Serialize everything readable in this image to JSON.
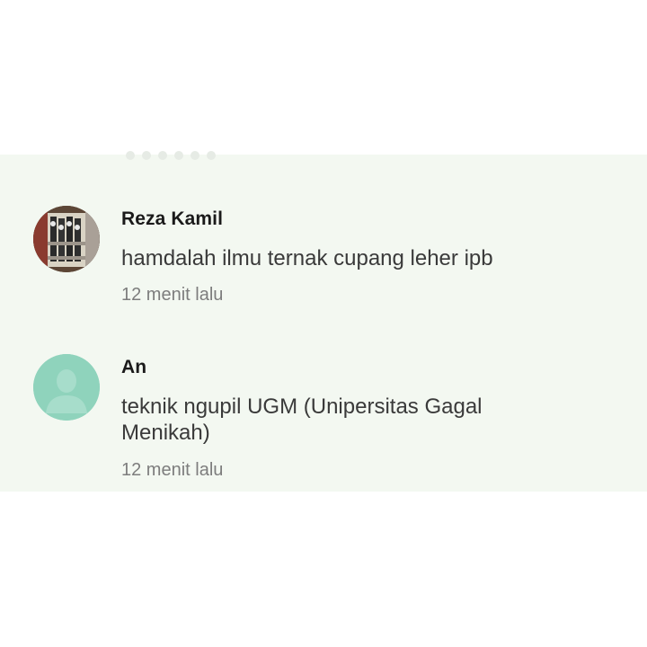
{
  "comments": [
    {
      "author": "Reza Kamil",
      "text": "hamdalah ilmu ternak cupang leher ipb",
      "time": "12 menit lalu",
      "avatar": "photo-avatar"
    },
    {
      "author": "An",
      "text": "teknik ngupil UGM (Unipersitas Gagal Menikah)",
      "time": "12 menit lalu",
      "avatar": "default-user-avatar-icon"
    }
  ],
  "colors": {
    "panel_background": "#f3f8f1",
    "default_avatar": "#8fd3bc",
    "author_text": "#1a1a1a",
    "body_text": "#3a3a3a",
    "time_text": "#7d7d7d"
  }
}
